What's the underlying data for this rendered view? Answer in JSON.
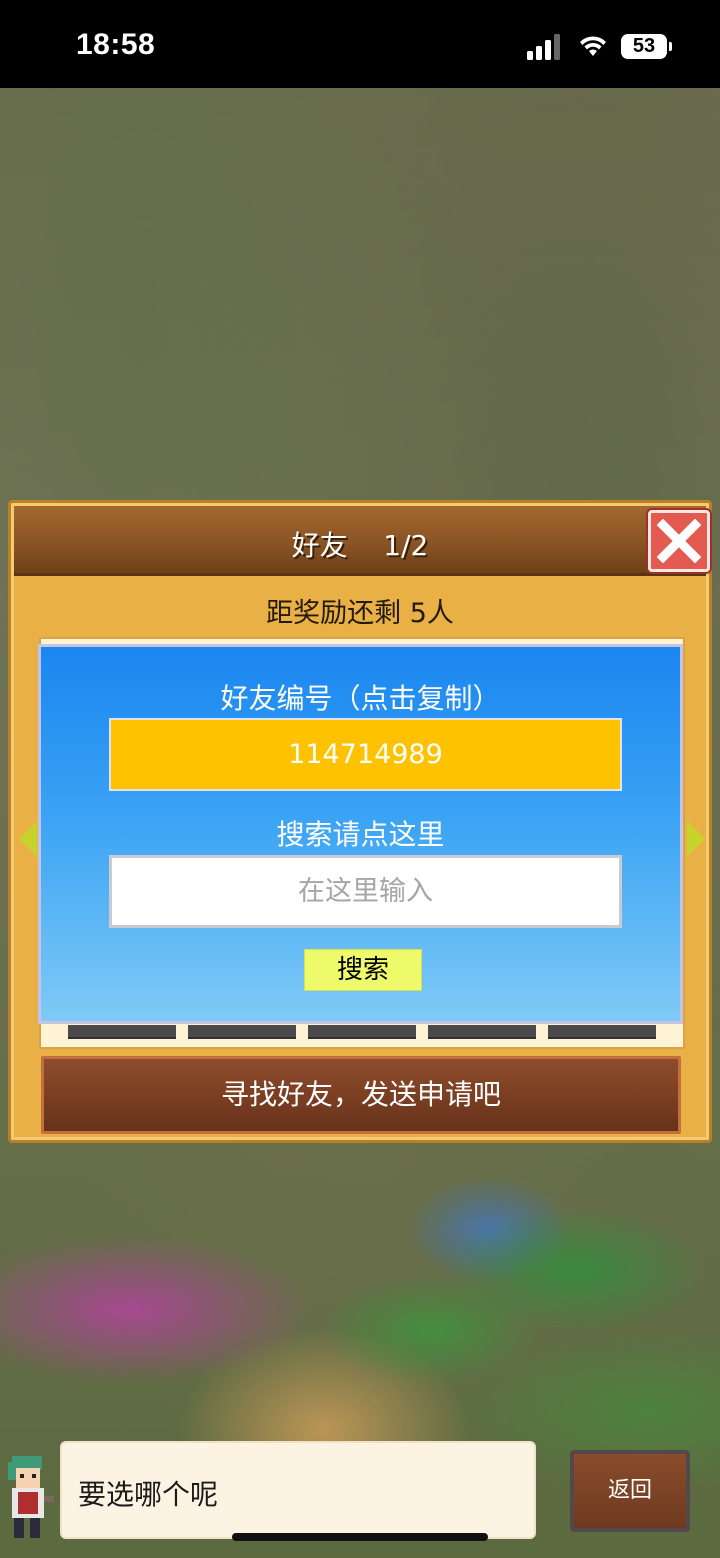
{
  "status_bar": {
    "time": "18:58",
    "battery": "53"
  },
  "dialog": {
    "title": "好友    1/2",
    "reward_text": "距奖励还剩 5人",
    "find_friends_label": "寻找好友，发送申请吧"
  },
  "popup": {
    "friend_id_label": "好友编号（点击复制）",
    "friend_id": "114714989",
    "search_label": "搜索请点这里",
    "search_placeholder": "在这里输入",
    "search_button": "搜索"
  },
  "bottom": {
    "speech": "要选哪个呢",
    "back_label": "返回"
  },
  "icons": [
    "signal-icon",
    "wifi-icon",
    "battery-icon",
    "close-icon",
    "arrow-left-icon",
    "arrow-right-icon",
    "character-avatar"
  ],
  "colors": {
    "dialog_bg": "#e9b046",
    "header_brown": "#8b5424",
    "close_red": "#e25a50",
    "popup_blue": "#1a86f0",
    "friend_id_yellow": "#ffc200",
    "search_button_yellow": "#eefa6a"
  }
}
